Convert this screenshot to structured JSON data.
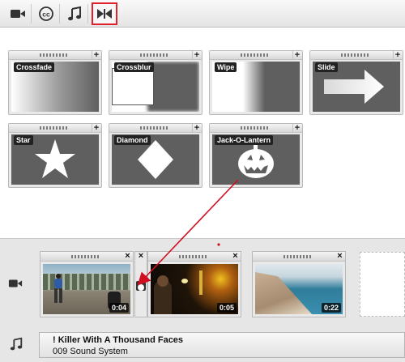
{
  "toolbar": {
    "tabs": [
      {
        "icon": "video-camera-icon"
      },
      {
        "icon": "closed-captions-icon",
        "label": "cc"
      },
      {
        "icon": "music-note-icon"
      },
      {
        "icon": "bowtie-transition-icon",
        "selected": true
      }
    ]
  },
  "transitions": [
    {
      "label": "Crossfade"
    },
    {
      "label": "Crossblur"
    },
    {
      "label": "Wipe"
    },
    {
      "label": "Slide"
    },
    {
      "label": "Star"
    },
    {
      "label": "Diamond"
    },
    {
      "label": "Jack-O-Lantern"
    }
  ],
  "tile_add_label": "+",
  "clips": [
    {
      "duration": "0:04"
    },
    {
      "duration": "0:05"
    },
    {
      "duration": "0:22"
    }
  ],
  "close_label": "×",
  "audio": {
    "title": "! Killer With A Thousand Faces",
    "artist": "009 Sound System"
  },
  "colors": {
    "highlight": "#e0202a",
    "arrow": "#d01020"
  }
}
